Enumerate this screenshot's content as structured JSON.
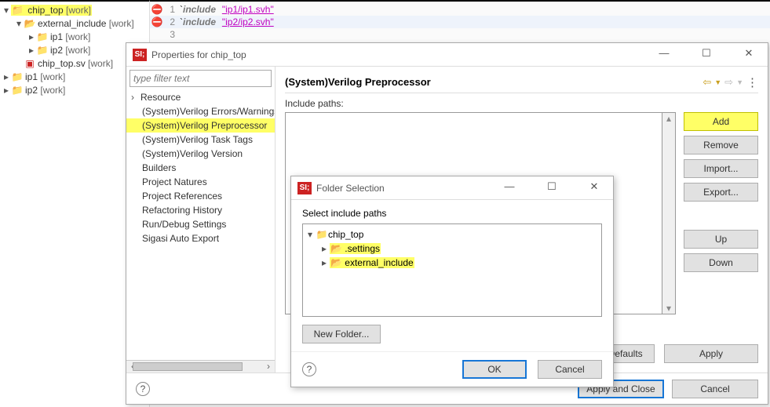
{
  "tree": {
    "root": {
      "name": "chip_top",
      "suffix": "[work]"
    },
    "extinc": {
      "name": "external_include",
      "suffix": "[work]"
    },
    "ip1a": {
      "name": "ip1",
      "suffix": "[work]"
    },
    "ip2a": {
      "name": "ip2",
      "suffix": "[work]"
    },
    "svfile": {
      "name": "chip_top.sv",
      "suffix": "[work]"
    },
    "ip1b": {
      "name": "ip1",
      "suffix": "[work]"
    },
    "ip2b": {
      "name": "ip2",
      "suffix": "[work]"
    }
  },
  "editor": {
    "lines": [
      {
        "n": "1",
        "pre": "`",
        "kw": "include",
        "str": "\"ip1/ip1.svh\""
      },
      {
        "n": "2",
        "pre": "`",
        "kw": "include",
        "str": "\"ip2/ip2.svh\""
      },
      {
        "n": "3",
        "pre": "",
        "kw": "",
        "str": ""
      }
    ]
  },
  "propsDlg": {
    "title": "Properties for chip_top",
    "filter_placeholder": "type filter text",
    "categories": {
      "resource": "Resource",
      "errors": "(System)Verilog Errors/Warnings",
      "preproc": "(System)Verilog Preprocessor",
      "tasktags": "(System)Verilog Task Tags",
      "version": "(System)Verilog Version",
      "builders": "Builders",
      "natures": "Project Natures",
      "refs": "Project References",
      "refactor": "Refactoring History",
      "rundebug": "Run/Debug Settings",
      "sigasi": "Sigasi Auto Export"
    },
    "section_title": "(System)Verilog Preprocessor",
    "include_label": "Include paths:",
    "buttons": {
      "add": "Add",
      "remove": "Remove",
      "import": "Import...",
      "export": "Export...",
      "up": "Up",
      "down": "Down",
      "restore": "Restore Defaults",
      "apply": "Apply",
      "applyclose": "Apply and Close",
      "cancel": "Cancel"
    }
  },
  "folderDlg": {
    "title": "Folder Selection",
    "label": "Select include paths",
    "root": "chip_top",
    "settings": ".settings",
    "extinc": "external_include",
    "newfolder": "New Folder...",
    "ok": "OK",
    "cancel": "Cancel"
  }
}
